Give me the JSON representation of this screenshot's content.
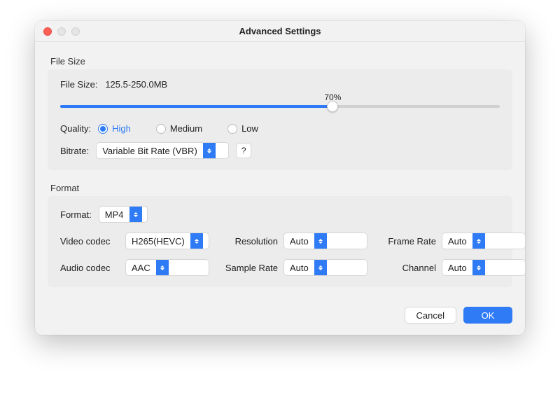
{
  "window": {
    "title": "Advanced Settings"
  },
  "filesize_section": {
    "heading": "File Size",
    "label": "File Size:",
    "value": "125.5-250.0MB",
    "slider": {
      "percent_label": "70%",
      "percent": 70
    }
  },
  "quality": {
    "label": "Quality:",
    "options": {
      "high": "High",
      "medium": "Medium",
      "low": "Low"
    },
    "selected": "high"
  },
  "bitrate": {
    "label": "Bitrate:",
    "value": "Variable Bit Rate (VBR)",
    "help": "?"
  },
  "format_section": {
    "heading": "Format",
    "format_label": "Format:",
    "format_value": "MP4",
    "video_codec_label": "Video codec",
    "video_codec_value": "H265(HEVC)",
    "resolution_label": "Resolution",
    "resolution_value": "Auto",
    "frame_rate_label": "Frame Rate",
    "frame_rate_value": "Auto",
    "audio_codec_label": "Audio codec",
    "audio_codec_value": "AAC",
    "sample_rate_label": "Sample Rate",
    "sample_rate_value": "Auto",
    "channel_label": "Channel",
    "channel_value": "Auto"
  },
  "footer": {
    "cancel": "Cancel",
    "ok": "OK"
  },
  "colors": {
    "accent": "#2f7bf5"
  }
}
